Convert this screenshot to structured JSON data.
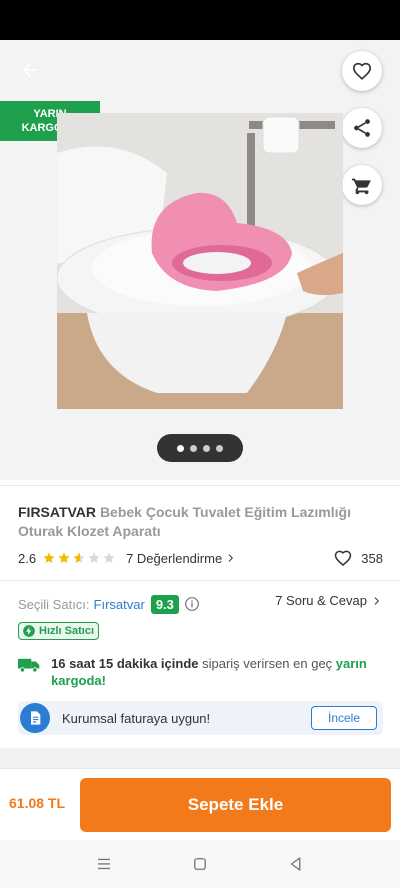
{
  "gallery": {
    "badge_line1": "YARIN",
    "badge_line2": "KARGODA",
    "dots_count": 4,
    "active_dot": 0
  },
  "product": {
    "brand": "FIRSATVAR",
    "name": "Bebek Çocuk Tuvalet Eğitim Lazımlığı Oturak Klozet Aparatı",
    "rating": "2.6",
    "rating_value": 2.6,
    "reviews_label": "7 Değerlendirme",
    "favorites_count": "358"
  },
  "seller": {
    "label": "Seçili Satıcı:",
    "name": "Fırsatvar",
    "score": "9.3",
    "qa_label": "7 Soru & Cevap",
    "fast_label": "Hızlı Satıcı"
  },
  "delivery": {
    "time": "16 saat 15 dakika içinde",
    "middle": " sipariş verirsen en geç ",
    "highlight": "yarın kargoda!"
  },
  "corporate": {
    "text": "Kurumsal faturaya uygun!",
    "button": "İncele"
  },
  "purchase": {
    "price": "61.08 TL",
    "add_to_cart": "Sepete Ekle"
  },
  "colors": {
    "accent": "#f27a1a",
    "green": "#1ea04d",
    "link": "#2b7cd3",
    "star": "#f6b900"
  },
  "icons": {
    "back": "arrow-left-icon",
    "favorite": "heart-icon",
    "share": "share-icon",
    "cart": "cart-icon",
    "info": "info-icon",
    "truck": "truck-icon",
    "invoice": "invoice-icon"
  }
}
